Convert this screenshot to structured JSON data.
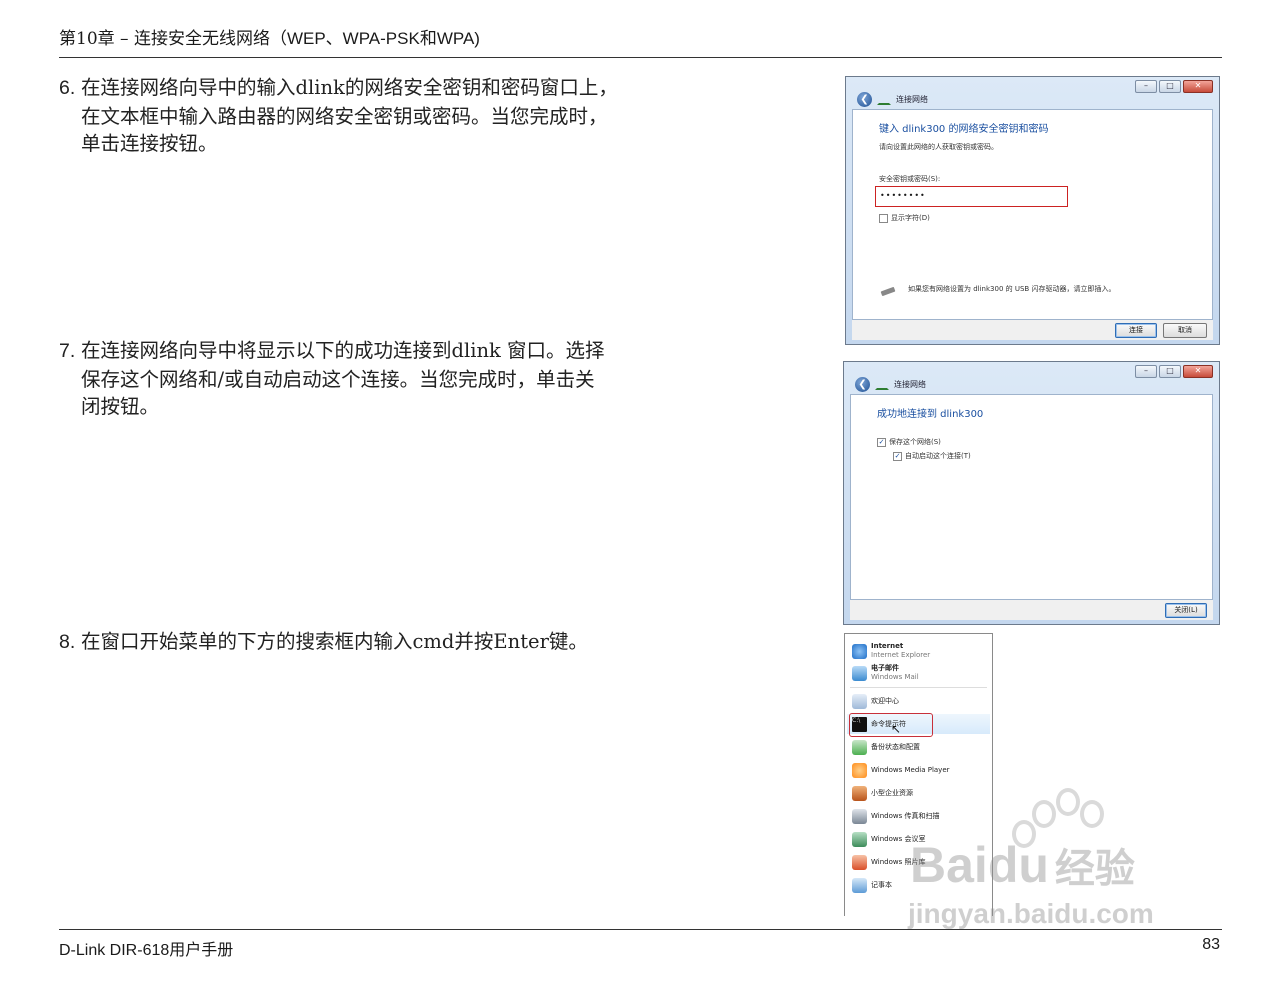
{
  "header": {
    "chapter": "第10章 – 连接安全无线网络（",
    "chapter_latin": "WEP、WPA-PSK",
    "chapter_mid": "和",
    "chapter_end": "WPA)"
  },
  "steps": [
    {
      "num": "6.",
      "lines": [
        "在连接网络向导中的输入dlink的网络安全密钥和密码窗口上，",
        "在文本框中输入路由器的网络安全密钥或密码。当您完成时，",
        "单击连接按钮。"
      ]
    },
    {
      "num": "7.",
      "lines": [
        "在连接网络向导中将显示以下的成功连接到dlink 窗口。选择",
        "保存这个网络和/或自动启动这个连接。当您完成时，单击关",
        "闭按钮。"
      ]
    },
    {
      "num": "8.",
      "lines": [
        "在窗口开始菜单的下方的搜索框内输入cmd并按Enter键。"
      ]
    }
  ],
  "win1": {
    "nav": "连接网络",
    "title": "键入 dlink300 的网络安全密钥和密码",
    "subtitle": "请向设置此网络的人获取密钥或密码。",
    "field_label": "安全密钥或密码(S):",
    "field_value": "••••••••",
    "show_chars": "显示字符(D)",
    "usb_hint": "如果您有网络设置为 dlink300 的 USB 闪存驱动器，请立即插入。",
    "connect_btn": "连接",
    "cancel_btn": "取消"
  },
  "win2": {
    "nav": "连接网络",
    "title": "成功地连接到 dlink300",
    "save_network": "保存这个网络(S)",
    "auto_start": "自动启动这个连接(T)",
    "close_btn": "关闭(L)"
  },
  "start_menu": {
    "items": [
      {
        "label": "Internet",
        "sub": "Internet Explorer",
        "icon": "internet-explorer-icon",
        "color": "#2a7bd6"
      },
      {
        "label": "电子邮件",
        "sub": "Windows Mail",
        "icon": "mail-icon",
        "color": "#3b8bd0"
      },
      {
        "label": "欢迎中心",
        "icon": "welcome-center-icon",
        "color": "#9fb9d8"
      },
      {
        "label": "命令提示符",
        "icon": "command-prompt-icon",
        "color": "#111111"
      },
      {
        "label": "备份状态和配置",
        "icon": "backup-icon",
        "color": "#4caf50"
      },
      {
        "label": "Windows Media Player",
        "icon": "media-player-icon",
        "color": "#ff8c1a"
      },
      {
        "label": "小型企业资源",
        "icon": "business-resources-icon",
        "color": "#b8541c"
      },
      {
        "label": "Windows 传真和扫描",
        "icon": "fax-scan-icon",
        "color": "#7a8795"
      },
      {
        "label": "Windows 会议室",
        "icon": "meeting-space-icon",
        "color": "#3d8c5a"
      },
      {
        "label": "Windows 照片库",
        "icon": "photo-gallery-icon",
        "color": "#d94f2a"
      },
      {
        "label": "记事本",
        "icon": "notepad-icon",
        "color": "#5d9bd6"
      }
    ]
  },
  "watermark": {
    "brand": "Bai",
    "brand2": "du",
    "suffix": "经验",
    "url": "jingyan.baidu.com"
  },
  "footer": {
    "left": "D-Link DIR-618用户手册",
    "page": "83"
  }
}
